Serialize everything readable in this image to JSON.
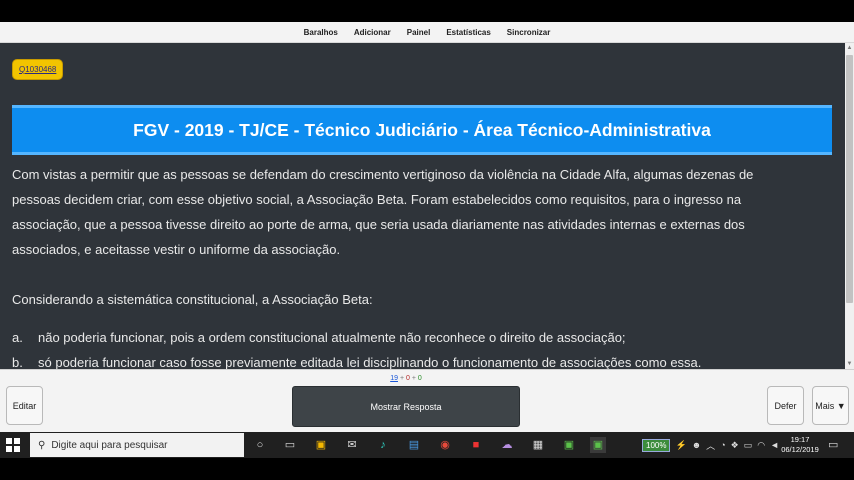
{
  "menu": [
    "Baralhos",
    "Adicionar",
    "Painel",
    "Estatísticas",
    "Sincronizar"
  ],
  "card": {
    "tag": "Q1030468",
    "banner_title": "FGV - 2019 - TJ/CE - Técnico Judiciário - Área Técnico-Administrativa",
    "question_lines": [
      "Com vistas a permitir que as pessoas se defendam do crescimento vertiginoso da violência na Cidade Alfa, algumas dezenas de",
      "pessoas decidem criar, com esse objetivo social, a Associação Beta. Foram estabelecidos como requisitos, para o ingresso na",
      "associação, que a pessoa tivesse direito ao porte de arma, que seria usada diariamente nas atividades internas e externas dos",
      "associados, e aceitasse vestir o uniforme da associação."
    ],
    "prompt": "Considerando a sistemática constitucional, a Associação Beta:",
    "options": [
      {
        "letter": "a.",
        "text": "não poderia funcionar, pois a ordem constitucional atualmente não reconhece o direito de associação;"
      },
      {
        "letter": "b.",
        "text": "só poderia funcionar caso fosse previamente editada lei disciplinando o funcionamento de associações como essa."
      }
    ]
  },
  "bottom": {
    "count_new": "19",
    "count_learn": "0",
    "count_review": "0",
    "edit_label": "Editar",
    "show_answer_label": "Mostrar Resposta",
    "defer_label": "Defer",
    "more_label": "Mais ▼"
  },
  "taskbar": {
    "search_placeholder": "Digite aqui para pesquisar",
    "battery": "100%",
    "time": "19:17",
    "date": "06/12/2019"
  },
  "colors": {
    "banner": "#0d8df0",
    "content_bg": "#2f343a",
    "tag_bg": "#f2c400"
  }
}
